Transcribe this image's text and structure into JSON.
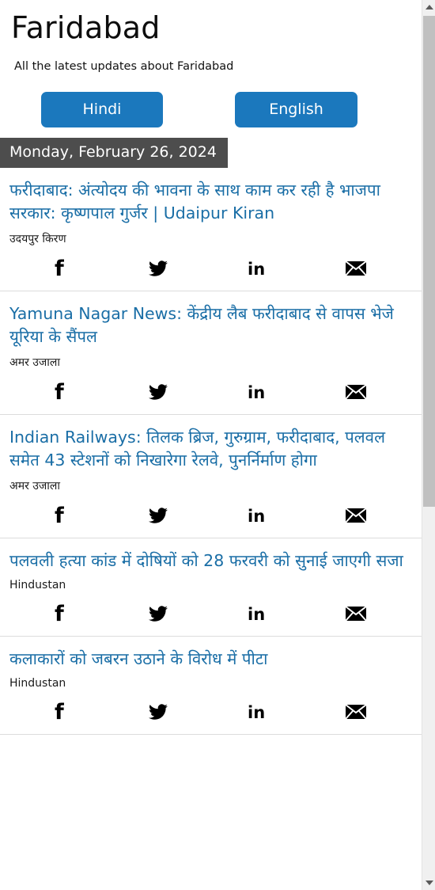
{
  "header": {
    "title": "Faridabad",
    "subtitle": "All the latest updates about Faridabad"
  },
  "language_buttons": {
    "hindi_label": "Hindi",
    "english_label": "English"
  },
  "date_header": "Monday, February 26, 2024",
  "share_icons": [
    {
      "name": "facebook-icon",
      "label": "f"
    },
    {
      "name": "twitter-icon",
      "label": "twitter"
    },
    {
      "name": "linkedin-icon",
      "label": "in"
    },
    {
      "name": "email-icon",
      "label": "email"
    }
  ],
  "articles": [
    {
      "headline": "फरीदाबाद: अंत्योदय की भावना के साथ काम कर रही है भाजपा सरकार: कृष्णपाल गुर्जर | Udaipur Kiran",
      "source": "उदयपुर किरण"
    },
    {
      "headline": "Yamuna Nagar News: केंद्रीय लैब फरीदाबाद से वापस भेजे यूरिया के सैंपल",
      "source": "अमर उजाला"
    },
    {
      "headline": "Indian Railways: तिलक ब्रिज, गुरुग्राम, फरीदाबाद, पलवल समेत 43 स्टेशनों को निखारेगा रेलवे, पुनर्निर्माण होगा",
      "source": "अमर उजाला"
    },
    {
      "headline": "पलवली हत्या कांड में दोषियों को 28 फरवरी को सुनाई जाएगी सजा",
      "source": "Hindustan"
    },
    {
      "headline": "कलाकारों को जबरन उठाने के विरोध में पीटा",
      "source": "Hindustan"
    }
  ],
  "colors": {
    "accent_blue": "#1b78bd",
    "headline_blue": "#1a6ea6",
    "date_bar_bg": "#4d4d4d"
  }
}
